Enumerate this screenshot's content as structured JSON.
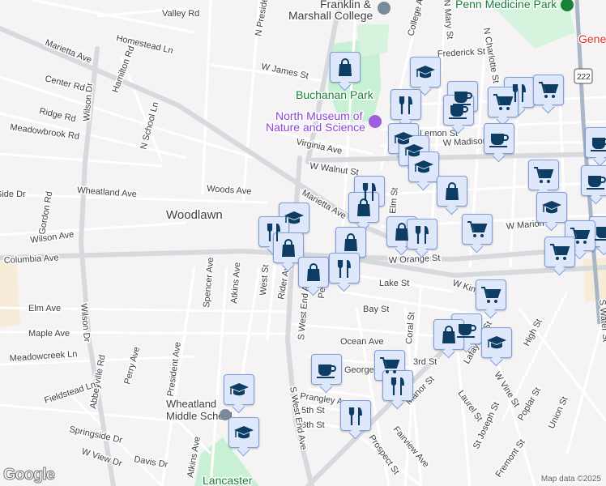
{
  "map": {
    "places": {
      "woodlawn": "Woodlawn",
      "buchanan_park": "Buchanan Park",
      "north_museum_1": "North Museum of",
      "north_museum_2": "Nature and Science",
      "fm_college_1": "Franklin &",
      "fm_college_2": "Marshall College",
      "penn_medicine_park": "Penn Medicine Park",
      "general": "Gene",
      "wheatland_1": "Wheatland",
      "wheatland_2": "Middle School",
      "lancaster": "Lancaster",
      "route_222": "222"
    },
    "streets": [
      "Valley Rd",
      "Homestead Ln",
      "Marietta Ave",
      "Center Rd",
      "Hamilton Rd",
      "Ridge Rd",
      "Meadowbrook Rd",
      "N School Ln",
      "Wilson Dr",
      "Wheatland Ave",
      "Woods Ave",
      "Gordon Rd",
      "Wilson Ave",
      "Columbia Ave",
      "Abbeyville Rd",
      "Spencer Ave",
      "Atkins Ave",
      "West St",
      "Rider Ave",
      "S West End Ave",
      "Elm Ave",
      "Maple Ave",
      "Meadowcreek Ln",
      "Perry Ave",
      "S President Ave",
      "Fieldstead Ln",
      "Springside Dr",
      "W View Dr",
      "Davis Dr",
      "W James St",
      "Virginia Ave",
      "W Walnut St",
      "Marietta Ave",
      "Elm St",
      "W Orange St",
      "Lake St",
      "W King St",
      "Bay St",
      "Ocean Ave",
      "George St",
      "Prangley Ave",
      "5th St",
      "6th St",
      "Coral St",
      "3rd St",
      "Manor St",
      "Laurel St",
      "St Joseph St",
      "Fremont St",
      "Poplar St",
      "Union St",
      "High St",
      "W Vine St",
      "Lafayette St",
      "Fairview Ave",
      "Prospect St",
      "W Madison St",
      "W Marion St",
      "N Mary St",
      "N Charlotte St",
      "College Ave",
      "N President Ave",
      "Frederick St",
      "Lemon St",
      "S Water St",
      "Atkins Ave",
      "S West End Ave",
      "Fremont St",
      "N School Ln",
      "Penn St",
      "Wilson Dr",
      "Side Dr"
    ],
    "attribution": "Map data ©2025",
    "logo": "Google"
  },
  "icons": {
    "shopping": "shopping-bag-icon",
    "grad": "graduation-cap-icon",
    "dining": "fork-knife-icon",
    "coffee": "coffee-cup-icon",
    "cart": "shopping-cart-icon"
  },
  "colors": {
    "marker_bg": "#dfe8fb",
    "marker_border": "#7f9fd9",
    "icon": "#0d3d63",
    "park": "#c8f0d4",
    "road": "#ffffff",
    "major_road": "#d6d9de"
  }
}
